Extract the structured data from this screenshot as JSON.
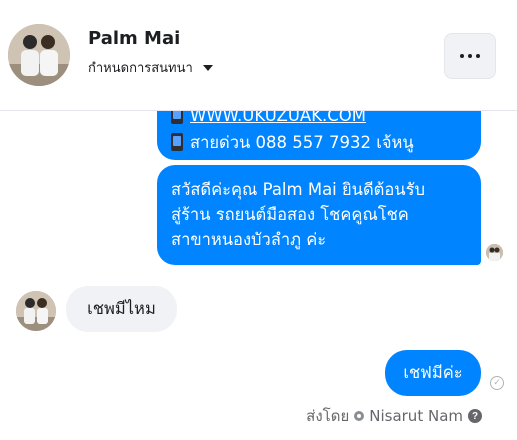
{
  "header": {
    "name": "Palm Mai",
    "subtitle": "กำหนดการสนทนา"
  },
  "messages": {
    "m1_url": "WWW.UKUZUAK.COM",
    "m1_phone": "สายด่วน 088 557 7932 เจ้หนู",
    "m2_line1": "สวัสดีค่ะคุณ Palm Mai ยินดีต้อนรับ",
    "m2_line2": "สู่ร้าน รถยนต์มือสอง โชคคูณโชค",
    "m2_line3": "สาขาหนองบัวลำภู ค่ะ",
    "incoming": "เชพมีไหม",
    "reply": "เชฟมีค่ะ"
  },
  "footer": {
    "sent_by_label": "ส่งโดย",
    "sender": "Nisarut Nam"
  },
  "colors": {
    "outgoing_bubble": "#0084ff",
    "incoming_bubble": "#f0f2f5"
  },
  "icons": [
    "phone-icon",
    "more-icon",
    "caret-down-icon",
    "read-receipt-avatar",
    "sent-check-icon",
    "gear-icon",
    "help-icon"
  ]
}
